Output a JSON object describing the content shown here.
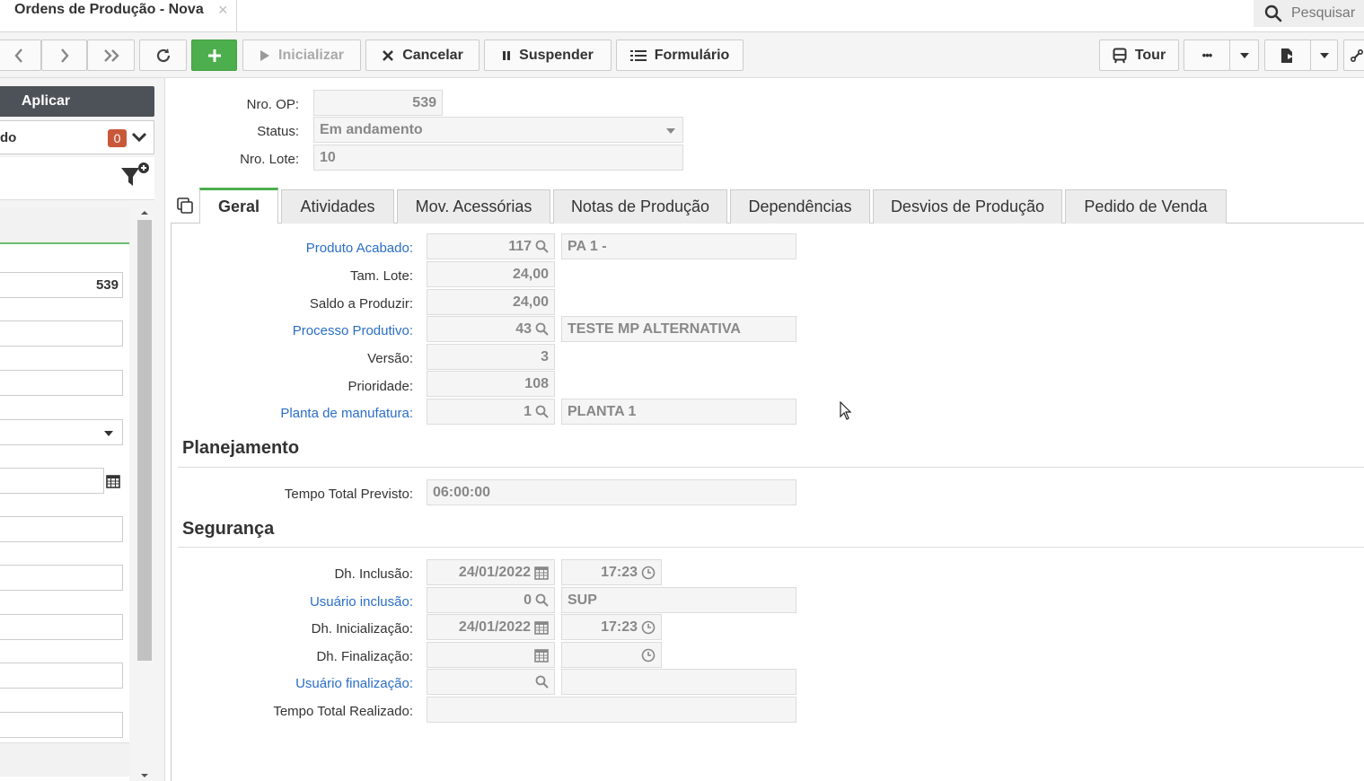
{
  "window": {
    "tab_title": "Ordens de Produção - Nova",
    "close_glyph": "×",
    "search_placeholder": "Pesquisar"
  },
  "toolbar": {
    "inicializar": "Inicializar",
    "cancelar": "Cancelar",
    "suspender": "Suspender",
    "formulario": "Formulário",
    "tour": "Tour",
    "more": "•••"
  },
  "sidebar": {
    "apply_label": "Aplicar",
    "filter_label": "do",
    "filter_count": "0",
    "field_value": "539"
  },
  "header": {
    "nro_op_label": "Nro. OP:",
    "nro_op_value": "539",
    "status_label": "Status:",
    "status_value": "Em andamento",
    "nro_lote_label": "Nro. Lote:",
    "nro_lote_value": "10"
  },
  "tabs": [
    {
      "label": "Geral"
    },
    {
      "label": "Atividades"
    },
    {
      "label": "Mov. Acessórias"
    },
    {
      "label": "Notas de Produção"
    },
    {
      "label": "Dependências"
    },
    {
      "label": "Desvios de Produção"
    },
    {
      "label": "Pedido de Venda"
    }
  ],
  "geral": {
    "produto_acabado_label": "Produto Acabado:",
    "produto_acabado_code": "117",
    "produto_acabado_desc": "PA 1 -",
    "tam_lote_label": "Tam. Lote:",
    "tam_lote_value": "24,00",
    "saldo_label": "Saldo a Produzir:",
    "saldo_value": "24,00",
    "processo_label": "Processo Produtivo:",
    "processo_code": "43",
    "processo_desc": "TESTE MP ALTERNATIVA",
    "versao_label": "Versão:",
    "versao_value": "3",
    "prioridade_label": "Prioridade:",
    "prioridade_value": "108",
    "planta_label": "Planta de manufatura:",
    "planta_code": "1",
    "planta_desc": "PLANTA 1"
  },
  "planejamento": {
    "title": "Planejamento",
    "tempo_previsto_label": "Tempo Total Previsto:",
    "tempo_previsto_value": "06:00:00"
  },
  "seguranca": {
    "title": "Segurança",
    "dh_inclusao_label": "Dh. Inclusão:",
    "dh_inclusao_date": "24/01/2022",
    "dh_inclusao_time": "17:23",
    "usuario_inclusao_label": "Usuário inclusão:",
    "usuario_inclusao_code": "0",
    "usuario_inclusao_name": "SUP",
    "dh_inicializacao_label": "Dh. Inicialização:",
    "dh_inicializacao_date": "24/01/2022",
    "dh_inicializacao_time": "17:23",
    "dh_finalizacao_label": "Dh. Finalização:",
    "usuario_finalizacao_label": "Usuário finalização:",
    "tempo_realizado_label": "Tempo Total Realizado:"
  },
  "colors": {
    "accent_green": "#4cae4c",
    "link_blue": "#2a6ec6",
    "badge_red": "#c9573a",
    "apply_dark": "#4d5259"
  }
}
